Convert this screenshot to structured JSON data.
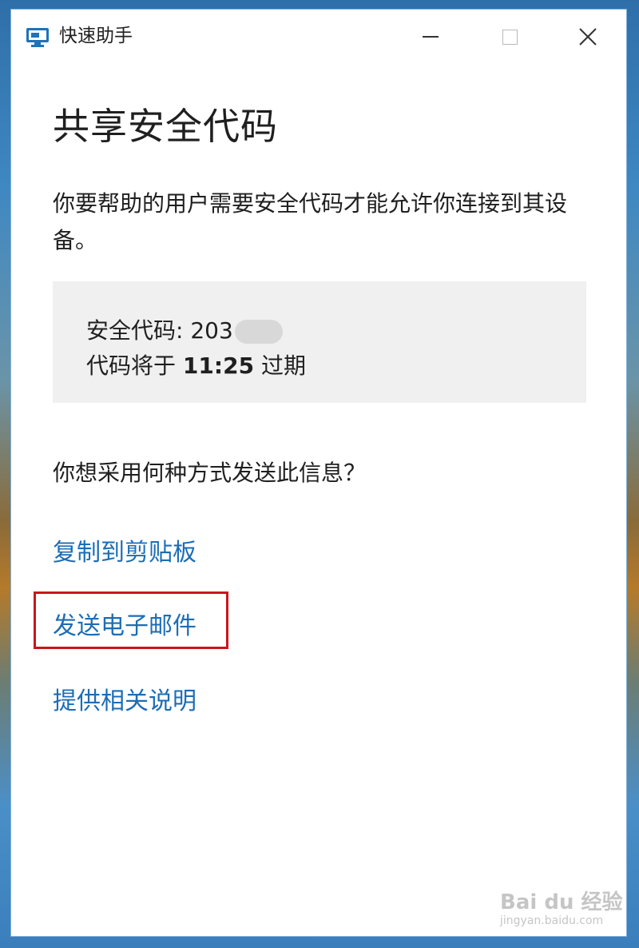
{
  "window": {
    "title": "快速助手",
    "icon": "quick-assist-icon",
    "buttons": {
      "minimize": "minimize-icon",
      "maximize": "maximize-icon",
      "close": "close-icon"
    }
  },
  "main": {
    "heading": "共享安全代码",
    "description": "你要帮助的用户需要安全代码才能允许你连接到其设备。",
    "code_box": {
      "code_label": "安全代码:",
      "code_value": "203",
      "expiry_prefix": "代码将于",
      "expiry_time": "11:25",
      "expiry_suffix": "过期"
    },
    "question": "你想采用何种方式发送此信息？",
    "links": {
      "copy": "复制到剪贴板",
      "email": "发送电子邮件",
      "help": "提供相关说明"
    }
  },
  "watermark": {
    "main": "Bai du 经验",
    "sub": "jingyan.baidu.com"
  },
  "colors": {
    "link": "#1c6db6",
    "highlight": "#c9161d",
    "code_box_bg": "#f0f0f0"
  }
}
